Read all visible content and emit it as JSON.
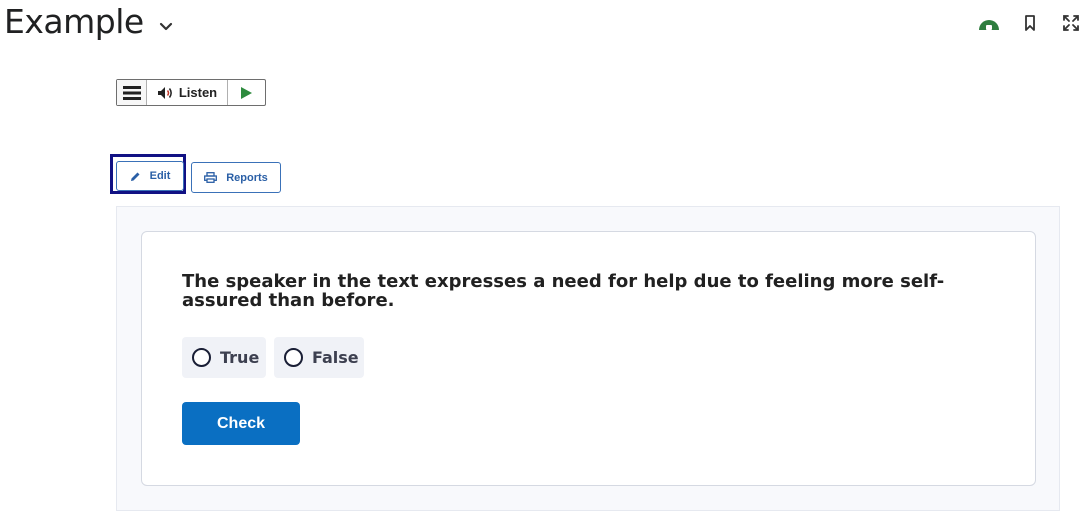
{
  "header": {
    "title": "Example"
  },
  "icons": {
    "title_chevron": "chevron-down-icon",
    "top_right": [
      "cloud-status-icon",
      "bookmark-icon",
      "fullscreen-icon"
    ],
    "menu": "menu-icon",
    "speaker": "speaker-icon",
    "play": "play-icon",
    "edit": "pencil-icon",
    "reports": "printer-icon"
  },
  "listen_toolbar": {
    "listen_label": "Listen"
  },
  "actions": {
    "edit_label": "Edit",
    "reports_label": "Reports"
  },
  "question": {
    "text": "The speaker in the text expresses a need for help due to feeling more self-assured than before.",
    "options": [
      {
        "label": "True",
        "selected": false
      },
      {
        "label": "False",
        "selected": false
      }
    ],
    "check_label": "Check"
  },
  "colors": {
    "accent_blue": "#0a6fc2",
    "link_blue": "#2a5fa6",
    "focus_ring": "#111184",
    "status_green": "#2e7d3e",
    "play_green": "#2e8b3e"
  }
}
